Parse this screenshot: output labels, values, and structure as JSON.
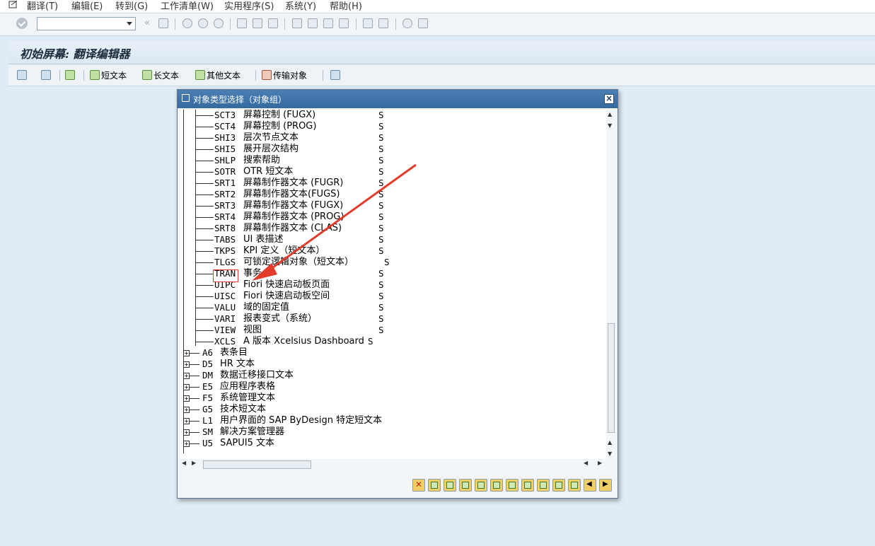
{
  "menubar": {
    "items": [
      "翻译(T)",
      "编辑(E)",
      "转到(G)",
      "工作清单(W)",
      "实用程序(S)",
      "系统(Y)",
      "帮助(H)"
    ]
  },
  "title": "初始屏幕: 翻译编辑器",
  "app_toolbar": {
    "short_text": "短文本",
    "long_text": "长文本",
    "other_text": "其他文本",
    "transport_object": "传输对象"
  },
  "dialog": {
    "title": "对象类型选择（对象组）",
    "close_symbol": "×",
    "rows": [
      {
        "code": "SCT3",
        "desc": "屏幕控制 (FUGX)",
        "status": "S"
      },
      {
        "code": "SCT4",
        "desc": "屏幕控制 (PROG)",
        "status": "S"
      },
      {
        "code": "SHI3",
        "desc": "层次节点文本",
        "status": "S"
      },
      {
        "code": "SHI5",
        "desc": "展开层次结构",
        "status": "S"
      },
      {
        "code": "SHLP",
        "desc": "搜索帮助",
        "status": "S"
      },
      {
        "code": "SOTR",
        "desc": "OTR 短文本",
        "status": "S"
      },
      {
        "code": "SRT1",
        "desc": "屏幕制作器文本 (FUGR)",
        "status": "S"
      },
      {
        "code": "SRT2",
        "desc": "屏幕制作器文本(FUGS)",
        "status": "S"
      },
      {
        "code": "SRT3",
        "desc": "屏幕制作器文本 (FUGX)",
        "status": "S"
      },
      {
        "code": "SRT4",
        "desc": "屏幕制作器文本 (PROG)",
        "status": "S"
      },
      {
        "code": "SRT8",
        "desc": "屏幕制作器文本 (CLAS)",
        "status": "S"
      },
      {
        "code": "TABS",
        "desc": "UI 表描述",
        "status": "S"
      },
      {
        "code": "TKPS",
        "desc": "KPI 定义（短文本）",
        "status": "S"
      },
      {
        "code": "TLGS",
        "desc": "可锁定逻辑对象（短文本）",
        "status": "S"
      },
      {
        "code": "TRAN",
        "desc": "事务",
        "status": "S"
      },
      {
        "code": "UIPC",
        "desc": "Fiori 快速启动板页面",
        "status": "S"
      },
      {
        "code": "UISC",
        "desc": "Fiori 快速启动板空间",
        "status": "S"
      },
      {
        "code": "VALU",
        "desc": "域的固定值",
        "status": "S"
      },
      {
        "code": "VARI",
        "desc": "报表变式（系统）",
        "status": "S"
      },
      {
        "code": "VIEW",
        "desc": "视图",
        "status": "S"
      },
      {
        "code": "XCLS",
        "desc": "A 版本 Xcelsius Dashboard",
        "status": "S"
      }
    ],
    "groups": [
      {
        "code": "A6",
        "desc": "表条目"
      },
      {
        "code": "D5",
        "desc": "HR 文本"
      },
      {
        "code": "DM",
        "desc": "数据迁移接口文本"
      },
      {
        "code": "E5",
        "desc": "应用程序表格"
      },
      {
        "code": "F5",
        "desc": "系统管理文本"
      },
      {
        "code": "G5",
        "desc": "技术短文本"
      },
      {
        "code": "L1",
        "desc": "用户界面的 SAP ByDesign 特定短文本"
      },
      {
        "code": "SM",
        "desc": "解决方案管理器"
      },
      {
        "code": "U5",
        "desc": "SAPUI5 文本"
      }
    ]
  },
  "colors": {
    "background": "#dfebf5",
    "dialog_title": "#3f74a9",
    "annotation": "#e23b2a"
  }
}
